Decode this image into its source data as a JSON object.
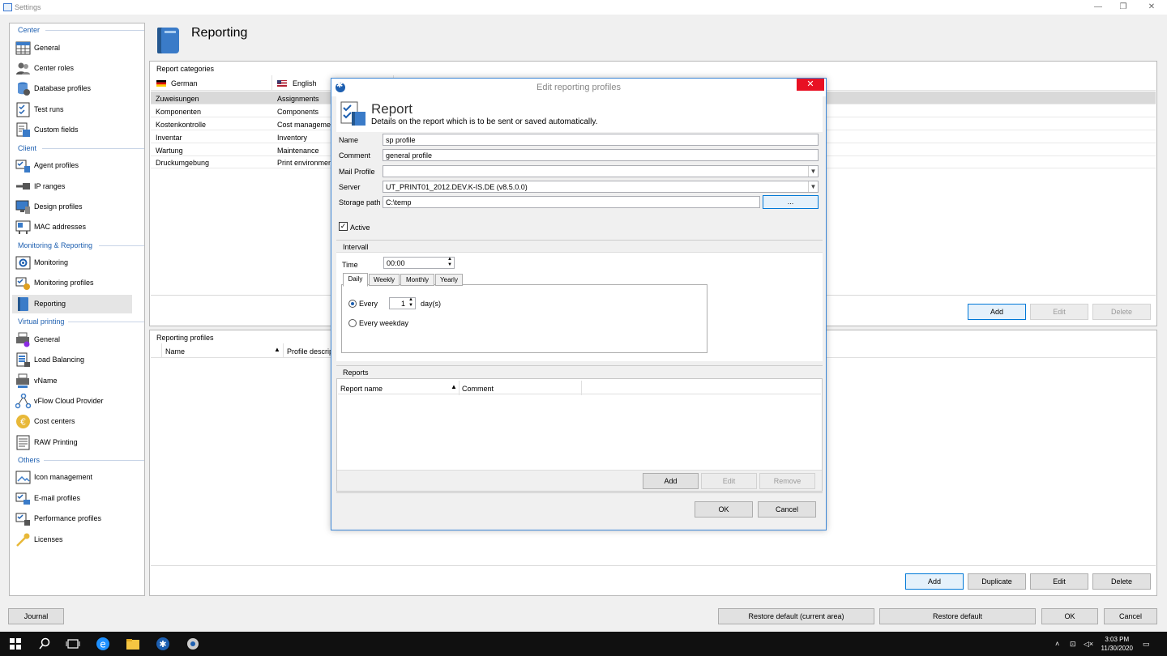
{
  "window": {
    "title": "Settings",
    "minimize_glyph": "—",
    "maximize_glyph": "❐",
    "close_glyph": "✕"
  },
  "sidebar": {
    "categories": [
      {
        "label": "Center",
        "items": [
          {
            "label": "General",
            "icon": "table-icon"
          },
          {
            "label": "Center roles",
            "icon": "users-icon"
          },
          {
            "label": "Database profiles",
            "icon": "database-icon"
          },
          {
            "label": "Test runs",
            "icon": "checklist-icon"
          },
          {
            "label": "Custom fields",
            "icon": "form-icon"
          }
        ]
      },
      {
        "label": "Client",
        "items": [
          {
            "label": "Agent profiles",
            "icon": "agent-icon"
          },
          {
            "label": "IP ranges",
            "icon": "network-icon"
          },
          {
            "label": "Design profiles",
            "icon": "design-icon"
          },
          {
            "label": "MAC addresses",
            "icon": "mac-icon"
          }
        ]
      },
      {
        "label": "Monitoring & Reporting",
        "items": [
          {
            "label": "Monitoring",
            "icon": "monitor-icon"
          },
          {
            "label": "Monitoring profiles",
            "icon": "monitoring-profile-icon"
          },
          {
            "label": "Reporting",
            "icon": "book-icon",
            "selected": true
          }
        ]
      },
      {
        "label": "Virtual printing",
        "items": [
          {
            "label": "General",
            "icon": "printer-icon"
          },
          {
            "label": "Load Balancing",
            "icon": "balance-icon"
          },
          {
            "label": "vName",
            "icon": "printer-name-icon"
          },
          {
            "label": "vFlow Cloud Provider",
            "icon": "cloud-flow-icon"
          },
          {
            "label": "Cost centers",
            "icon": "euro-icon"
          },
          {
            "label": "RAW Printing",
            "icon": "raw-doc-icon"
          }
        ]
      },
      {
        "label": "Others",
        "items": [
          {
            "label": "Icon management",
            "icon": "image-icon"
          },
          {
            "label": "E-mail profiles",
            "icon": "email-icon"
          },
          {
            "label": "Performance profiles",
            "icon": "performance-icon"
          },
          {
            "label": "Licenses",
            "icon": "key-icon"
          }
        ]
      }
    ]
  },
  "page": {
    "title": "Reporting"
  },
  "report_categories": {
    "header": "Report categories",
    "columns": [
      "German",
      "English"
    ],
    "rows": [
      [
        "Zuweisungen",
        "Assignments"
      ],
      [
        "Komponenten",
        "Components"
      ],
      [
        "Kostenkontrolle",
        "Cost managemen"
      ],
      [
        "Inventar",
        "Inventory"
      ],
      [
        "Wartung",
        "Maintenance"
      ],
      [
        "Druckumgebung",
        "Print environmen"
      ]
    ],
    "buttons": {
      "add": "Add",
      "edit": "Edit",
      "delete": "Delete"
    }
  },
  "reporting_profiles": {
    "header": "Reporting profiles",
    "columns": [
      "Name",
      "Profile descrip"
    ],
    "buttons": {
      "add": "Add",
      "duplicate": "Duplicate",
      "edit": "Edit",
      "delete": "Delete"
    }
  },
  "footer": {
    "journal": "Journal",
    "restore_area": "Restore default (current area)",
    "restore_default": "Restore default",
    "ok": "OK",
    "cancel": "Cancel"
  },
  "dialog": {
    "title": "Edit reporting profiles",
    "close_glyph": "✕",
    "heading": "Report",
    "subheading": "Details on the report which is to be sent or saved automatically.",
    "fields": {
      "name_label": "Name",
      "name_value": "sp profile",
      "comment_label": "Comment",
      "comment_value": "general profile",
      "mail_label": "Mail Profile",
      "mail_value": "",
      "server_label": "Server",
      "server_value": "UT_PRINT01_2012.DEV.K-IS.DE (v8.5.0.0)",
      "path_label": "Storage path",
      "path_value": "C:\\temp",
      "browse_label": "..."
    },
    "active_label": "Active",
    "active_checked": true,
    "interval": {
      "header": "Intervall",
      "time_label": "Time",
      "time_value": "00:00",
      "tabs": [
        "Daily",
        "Weekly",
        "Monthly",
        "Yearly"
      ],
      "active_tab": "Daily",
      "every_label": "Every",
      "every_value": "1",
      "days_label": "day(s)",
      "weekday_label": "Every weekday",
      "selected_option": "every"
    },
    "reports": {
      "header": "Reports",
      "columns": [
        "Report name",
        "Comment"
      ],
      "buttons": {
        "add": "Add",
        "edit": "Edit",
        "remove": "Remove"
      }
    },
    "ok": "OK",
    "cancel": "Cancel"
  },
  "taskbar": {
    "time": "3:03 PM",
    "date": "11/30/2020",
    "icons": [
      "windows-start-icon",
      "search-icon",
      "task-view-icon",
      "edge-icon",
      "file-explorer-icon",
      "settings-app-icon",
      "admin-app-icon"
    ]
  }
}
